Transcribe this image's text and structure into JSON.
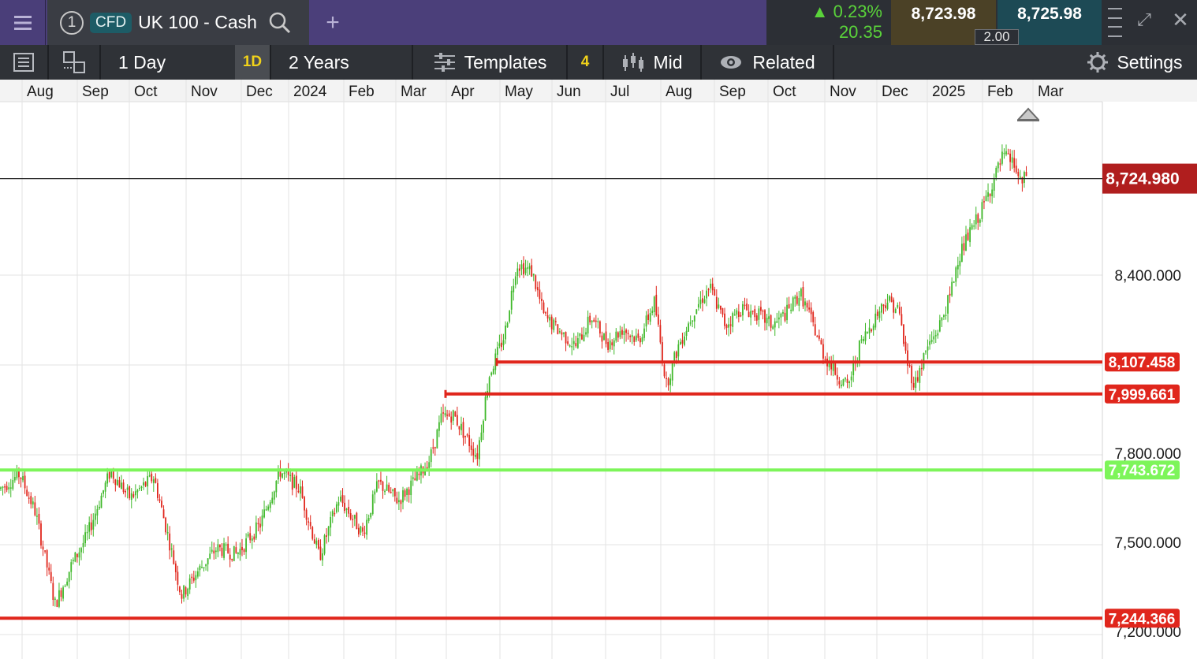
{
  "topbar": {
    "tab_number": "1",
    "instrument_type": "CFD",
    "instrument_name": "UK 100 - Cash",
    "change_pct": "0.23%",
    "change_abs": "20.35",
    "sell_price": "8,723.98",
    "buy_price": "8,725.98",
    "spread": "2.00",
    "colors": {
      "up": "#5ad33a",
      "topbar_bg": "#4b3f7a"
    },
    "icons": [
      "menu-icon",
      "search-icon",
      "add-tab-icon",
      "up-arrow-icon",
      "drag-handle-icon",
      "expand-icon",
      "close-icon"
    ]
  },
  "toolbar": {
    "interval": "1 Day",
    "interval_short": "1D",
    "range": "2 Years",
    "templates_label": "Templates",
    "studies_count": "4",
    "price_type": "Mid",
    "related_label": "Related",
    "settings_label": "Settings",
    "icons": [
      "list-icon",
      "layout-icon",
      "templates-sliders-icon",
      "candlestick-icon",
      "eye-icon",
      "gear-icon"
    ]
  },
  "chart_data": {
    "type": "candlestick",
    "x_tick_labels": [
      "Aug",
      "Sep",
      "Oct",
      "Nov",
      "Dec",
      "2024",
      "Feb",
      "Mar",
      "Apr",
      "May",
      "Jun",
      "Jul",
      "Aug",
      "Sep",
      "Oct",
      "Nov",
      "Dec",
      "2025",
      "Feb",
      "Mar"
    ],
    "y_tick_labels": [
      "8,400.000",
      "7,800.000",
      "7,500.000",
      "7,200.000"
    ],
    "y_ticks": [
      8400,
      7800,
      7500,
      7200
    ],
    "ylim": [
      7150,
      9100
    ],
    "grid": true,
    "current_price": {
      "value": 8724.98,
      "label": "8,724.980",
      "color": "#b01e1e"
    },
    "horizontal_lines": [
      {
        "value": 8107.458,
        "label": "8,107.458",
        "color": "#e0261c"
      },
      {
        "value": 7999.661,
        "label": "7,999.661",
        "color": "#e0261c"
      },
      {
        "value": 7743.672,
        "label": "7,743.672",
        "color": "#7df55a"
      },
      {
        "value": 7244.366,
        "label": "7,244.366",
        "color": "#e0261c"
      }
    ],
    "up_color": "#3fb82a",
    "down_color": "#e0261c",
    "path_points": [
      [
        0,
        7680
      ],
      [
        25,
        7730
      ],
      [
        45,
        7600
      ],
      [
        70,
        7290
      ],
      [
        90,
        7420
      ],
      [
        110,
        7520
      ],
      [
        140,
        7740
      ],
      [
        165,
        7650
      ],
      [
        195,
        7720
      ],
      [
        215,
        7500
      ],
      [
        230,
        7320
      ],
      [
        250,
        7400
      ],
      [
        275,
        7480
      ],
      [
        300,
        7460
      ],
      [
        330,
        7560
      ],
      [
        355,
        7740
      ],
      [
        380,
        7680
      ],
      [
        405,
        7450
      ],
      [
        430,
        7650
      ],
      [
        460,
        7530
      ],
      [
        480,
        7700
      ],
      [
        505,
        7640
      ],
      [
        530,
        7720
      ],
      [
        545,
        7780
      ],
      [
        560,
        7920
      ],
      [
        575,
        7930
      ],
      [
        590,
        7860
      ],
      [
        605,
        7790
      ],
      [
        620,
        8060
      ],
      [
        640,
        8200
      ],
      [
        655,
        8440
      ],
      [
        675,
        8410
      ],
      [
        690,
        8260
      ],
      [
        710,
        8210
      ],
      [
        730,
        8160
      ],
      [
        750,
        8260
      ],
      [
        770,
        8170
      ],
      [
        790,
        8220
      ],
      [
        810,
        8180
      ],
      [
        830,
        8310
      ],
      [
        845,
        8030
      ],
      [
        860,
        8160
      ],
      [
        880,
        8280
      ],
      [
        900,
        8360
      ],
      [
        920,
        8230
      ],
      [
        940,
        8290
      ],
      [
        960,
        8270
      ],
      [
        980,
        8230
      ],
      [
        1000,
        8280
      ],
      [
        1015,
        8340
      ],
      [
        1030,
        8240
      ],
      [
        1045,
        8130
      ],
      [
        1060,
        8070
      ],
      [
        1075,
        8020
      ],
      [
        1090,
        8160
      ],
      [
        1110,
        8260
      ],
      [
        1125,
        8320
      ],
      [
        1140,
        8280
      ],
      [
        1150,
        8110
      ],
      [
        1160,
        8030
      ],
      [
        1175,
        8150
      ],
      [
        1190,
        8220
      ],
      [
        1205,
        8330
      ],
      [
        1215,
        8460
      ],
      [
        1230,
        8540
      ],
      [
        1245,
        8620
      ],
      [
        1260,
        8720
      ],
      [
        1272,
        8800
      ],
      [
        1285,
        8780
      ],
      [
        1295,
        8700
      ],
      [
        1302,
        8740
      ]
    ]
  }
}
